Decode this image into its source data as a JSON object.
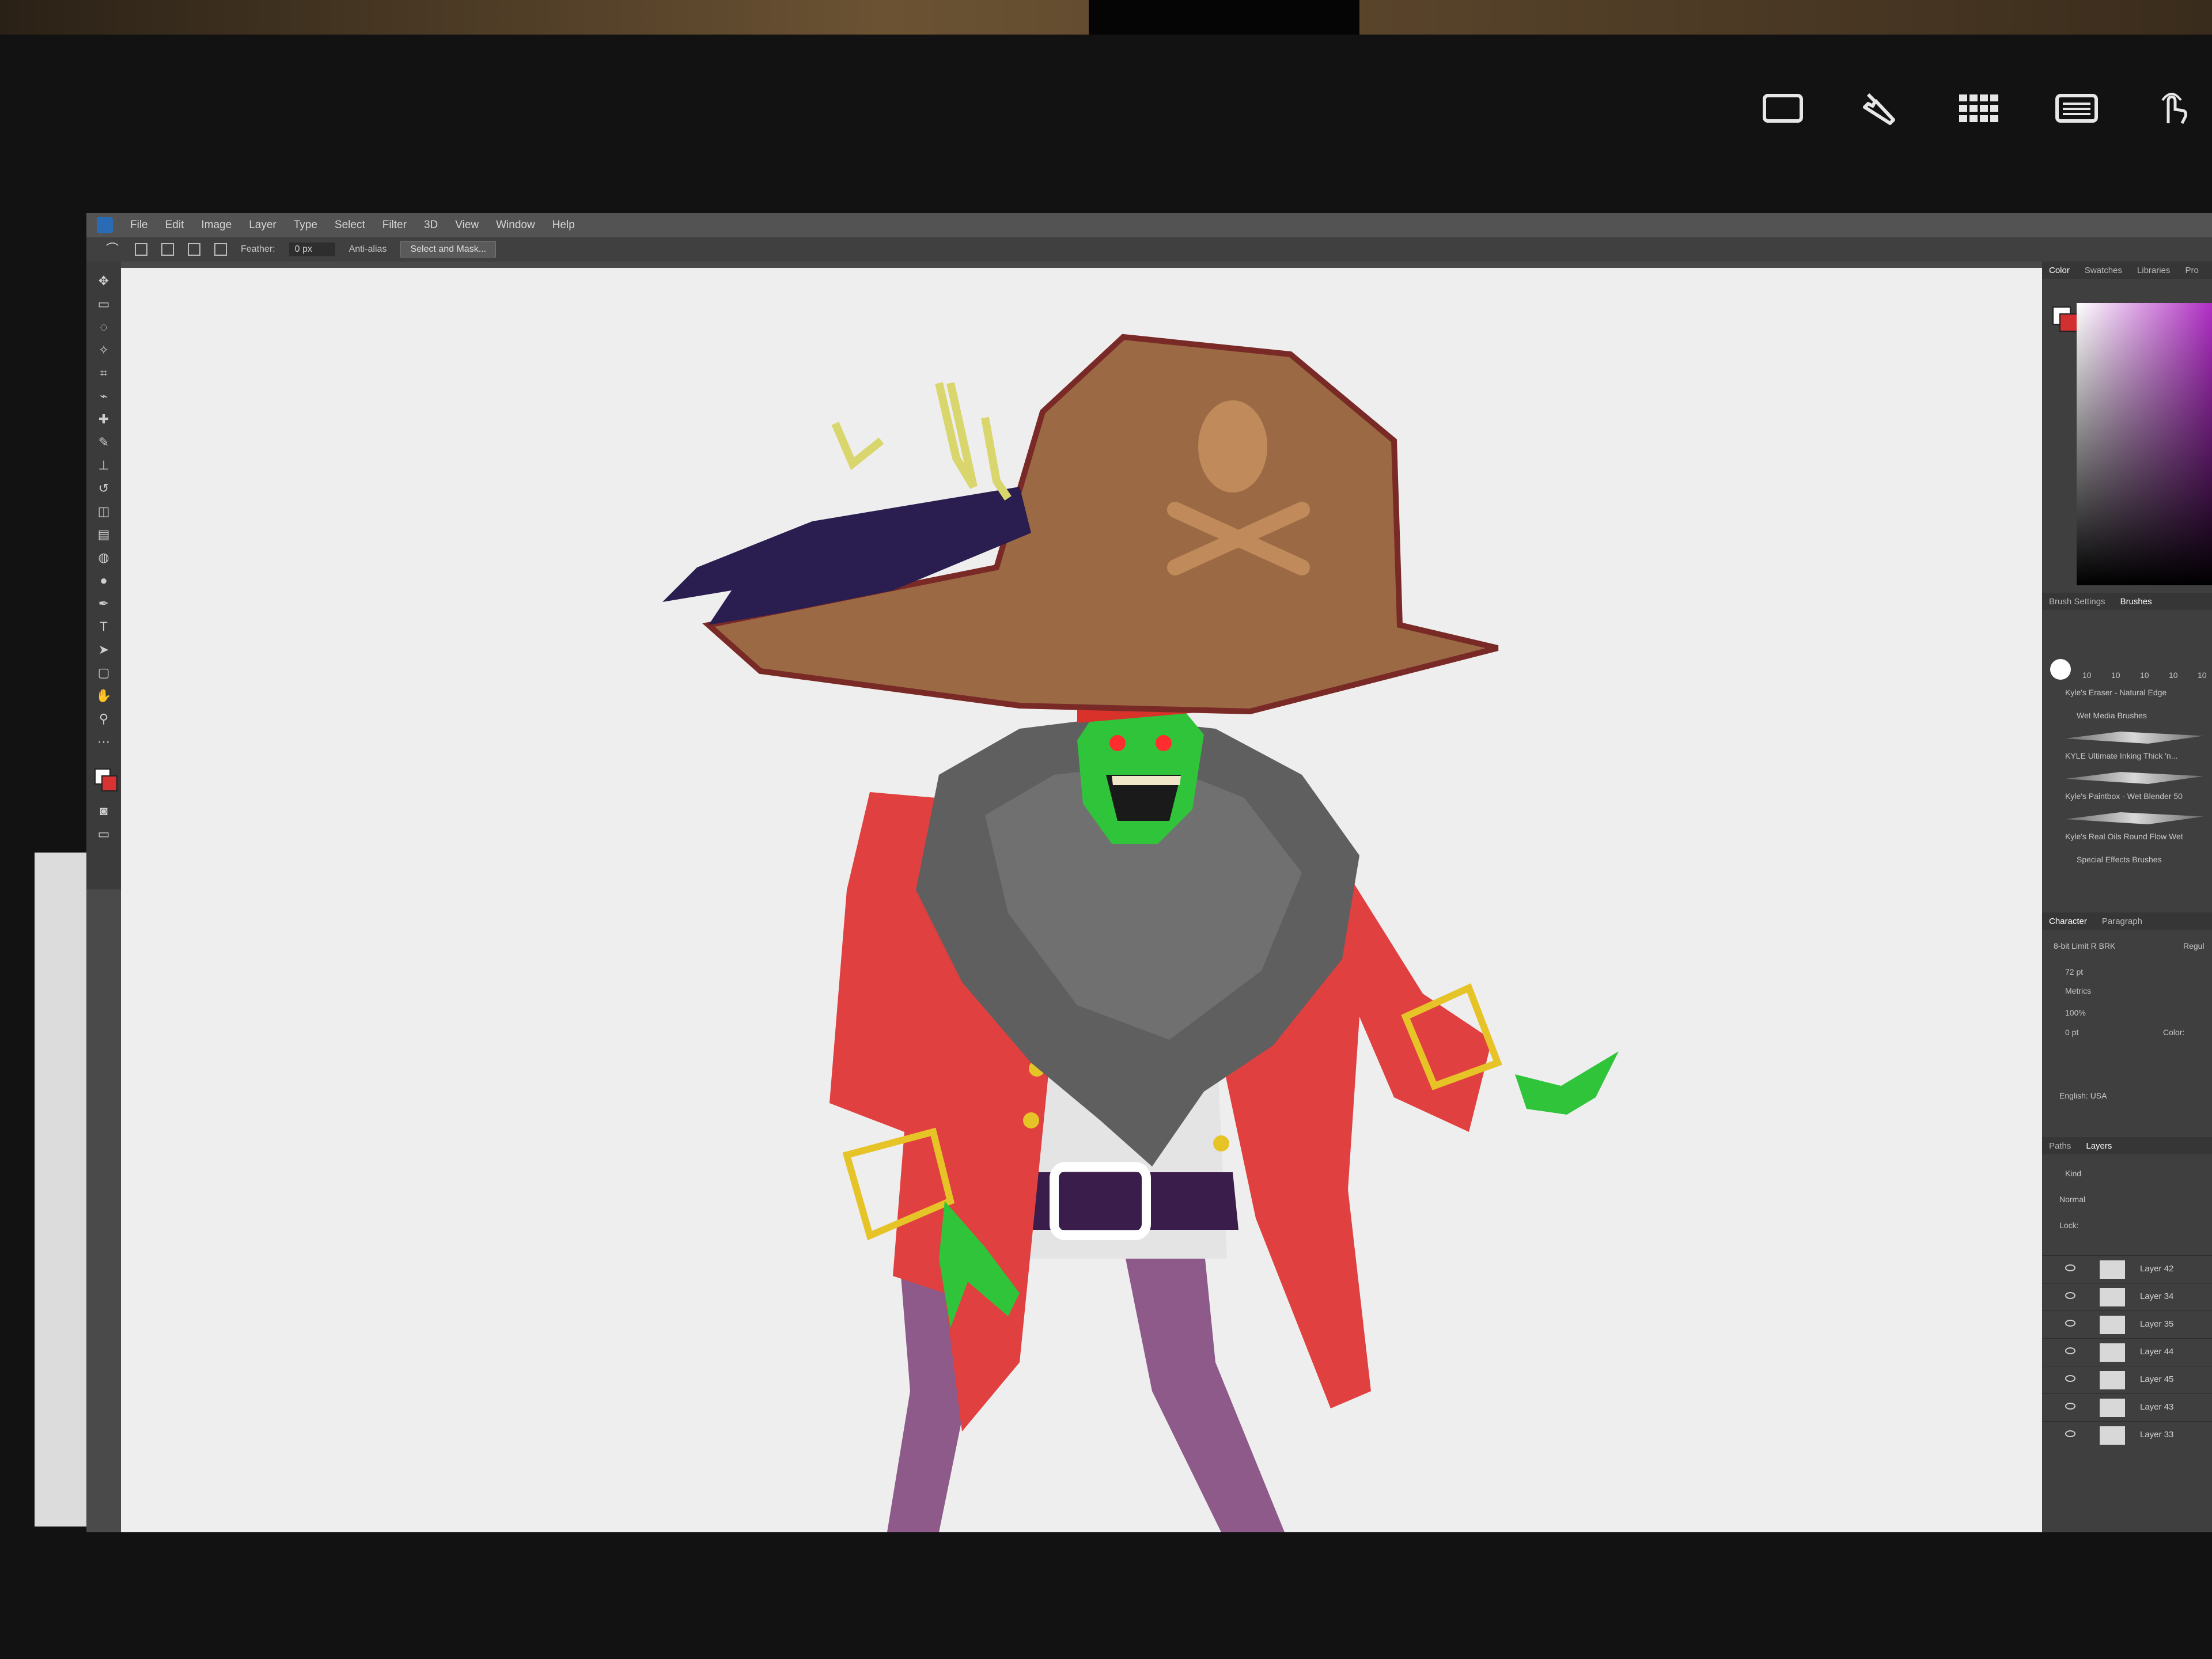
{
  "device": {
    "hardware_icons": [
      "rectangle-icon",
      "wrench-icon",
      "grid-icon",
      "keyboard-icon",
      "touch-gesture-icon"
    ]
  },
  "photoshop": {
    "menu": [
      "File",
      "Edit",
      "Image",
      "Layer",
      "Type",
      "Select",
      "Filter",
      "3D",
      "View",
      "Window",
      "Help"
    ],
    "options": {
      "feather_label": "Feather:",
      "feather_value": "0 px",
      "anti_alias_label": "Anti-alias",
      "select_mask_label": "Select and Mask..."
    },
    "panels": {
      "color_tabs": [
        "Color",
        "Swatches",
        "Libraries",
        "Pro"
      ],
      "brush_tabs": [
        "Brush Settings",
        "Brushes"
      ],
      "brush_size_labels": [
        "10",
        "10",
        "10",
        "10",
        "10"
      ],
      "brushes": [
        "Kyle's Eraser - Natural Edge",
        "Wet Media Brushes",
        "KYLE Ultimate Inking Thick 'n...",
        "Kyle's Paintbox - Wet Blender 50",
        "Kyle's Real Oils Round Flow Wet",
        "Special Effects Brushes"
      ],
      "char_tabs": [
        "Character",
        "Paragraph"
      ],
      "font_name": "8-bit Limit R BRK",
      "font_style": "Regul",
      "font_size": "72 pt",
      "kerning": "Metrics",
      "scale": "100%",
      "baseline": "0 pt",
      "color_label": "Color:",
      "language": "English: USA",
      "layer_tabs": [
        "Paths",
        "Layers"
      ],
      "layer_kind": "Kind",
      "blend_mode": "Normal",
      "lock_label": "Lock:",
      "layers": [
        "Layer 42",
        "Layer 34",
        "Layer 35",
        "Layer 44",
        "Layer 45",
        "Layer 43",
        "Layer 33"
      ]
    }
  },
  "colors": {
    "coat": "#e0403f",
    "hat": "#9b6a45",
    "beard": "#5f5f5f",
    "skin": "#2fc43a",
    "pants": "#8d5a8a",
    "feather": "#2a1d4f",
    "belt": "#3a1d4a",
    "gold": "#e6c327"
  }
}
